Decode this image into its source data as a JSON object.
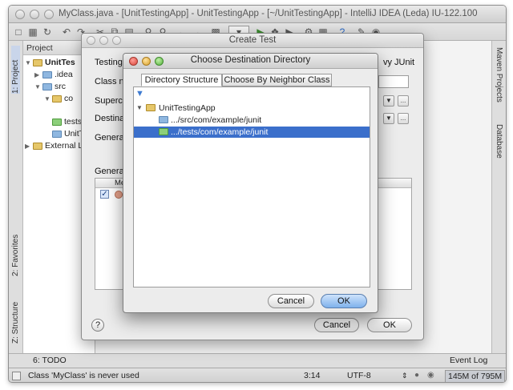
{
  "window": {
    "title": "MyClass.java - [UnitTestingApp] - UnitTestingApp - [~/UnitTestingApp] - IntelliJ IDEA (Leda) IU-122.100"
  },
  "left_tool_tabs": [
    "1: Project",
    "2: Favorites",
    "Z: Structure"
  ],
  "right_tool_tabs": [
    "Maven Projects",
    "Database"
  ],
  "project_panel": {
    "header": "Project",
    "items": [
      {
        "label": "UnitTes",
        "kind": "project"
      },
      {
        "label": ".idea",
        "kind": "folder"
      },
      {
        "label": "src",
        "kind": "folder"
      },
      {
        "label": "co",
        "kind": "package"
      },
      {
        "label": "tests",
        "kind": "test-folder"
      },
      {
        "label": "UnitTe",
        "kind": "module"
      },
      {
        "label": "External L",
        "kind": "libraries"
      }
    ]
  },
  "create_test": {
    "title": "Create Test",
    "testing_label": "Testing",
    "testing_value": "vy JUnit",
    "class_name_label": "Class na",
    "superclass_label": "Superclas",
    "destination_label": "Destina",
    "generate_label": "Generat",
    "generate_label_2": "Generat",
    "members_header": "Me",
    "ellipsis": "...",
    "cancel": "Cancel",
    "ok": "OK",
    "help": "?"
  },
  "choose_destination": {
    "title": "Choose Destination Directory",
    "tabs": [
      "Directory Structure",
      "Choose By Neighbor Class"
    ],
    "active_tab": 0,
    "tree": [
      {
        "label": "UnitTestingApp",
        "kind": "module",
        "selected": false
      },
      {
        "label": ".../src/com/example/junit",
        "kind": "source",
        "selected": false
      },
      {
        "label": ".../tests/com/example/junit",
        "kind": "test",
        "selected": true
      }
    ],
    "cancel": "Cancel",
    "ok": "OK"
  },
  "bottom_tools": {
    "todo": "6: TODO",
    "event_log": "Event Log"
  },
  "status_bar": {
    "message": "Class 'MyClass' is never used",
    "position": "3:14",
    "encoding": "UTF-8",
    "memory": "145M of 795M"
  },
  "colors": {
    "selection": "#3b6fcb",
    "default_button": "#7fb1ec"
  }
}
